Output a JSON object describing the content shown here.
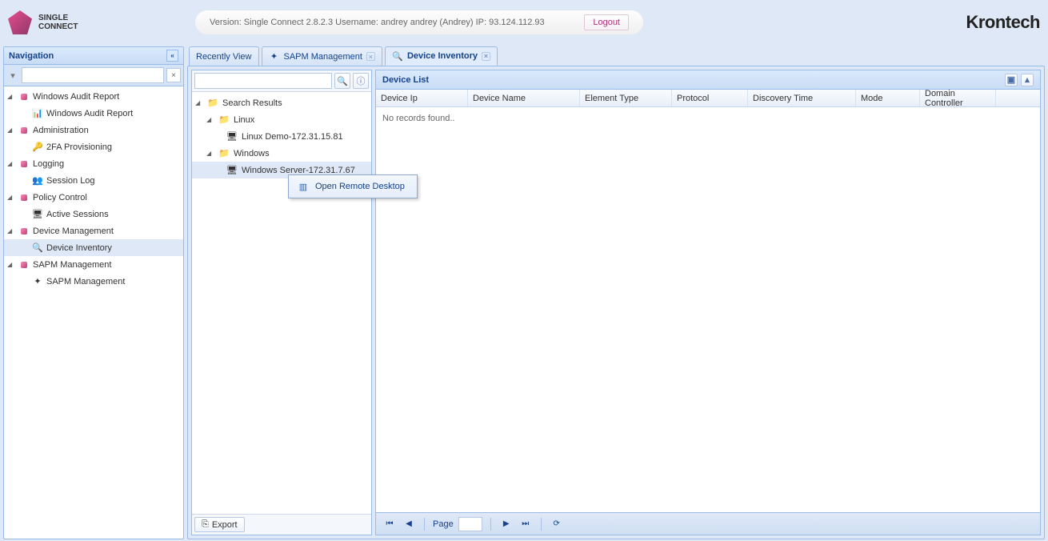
{
  "logo": {
    "line1": "SINGLE",
    "line2": "CONNECT"
  },
  "brand": "Krontech",
  "infoBar": "Version: Single Connect 2.8.2.3 Username: andrey andrey (Andrey) IP: 93.124.112.93",
  "logout": "Logout",
  "nav": {
    "title": "Navigation",
    "items": [
      {
        "label": "Windows Audit Report",
        "children": [
          {
            "label": "Windows Audit Report"
          }
        ]
      },
      {
        "label": "Administration",
        "children": [
          {
            "label": "2FA Provisioning"
          }
        ]
      },
      {
        "label": "Logging",
        "children": [
          {
            "label": "Session Log"
          }
        ]
      },
      {
        "label": "Policy Control",
        "children": [
          {
            "label": "Active Sessions"
          }
        ]
      },
      {
        "label": "Device Management",
        "children": [
          {
            "label": "Device Inventory",
            "selected": true
          }
        ]
      },
      {
        "label": "SAPM Management",
        "children": [
          {
            "label": "SAPM Management"
          }
        ]
      }
    ]
  },
  "tabs": [
    {
      "label": "Recently View",
      "closable": false
    },
    {
      "label": "SAPM Management",
      "closable": true
    },
    {
      "label": "Device Inventory",
      "closable": true,
      "active": true
    }
  ],
  "searchTree": {
    "root": "Search Results",
    "groups": [
      {
        "label": "Linux",
        "children": [
          {
            "label": "Linux Demo-172.31.15.81"
          }
        ]
      },
      {
        "label": "Windows",
        "children": [
          {
            "label": "Windows Server-172.31.7.67",
            "selected": true
          }
        ]
      }
    ]
  },
  "exportLabel": "Export",
  "grid": {
    "title": "Device List",
    "columns": [
      "Device Ip",
      "Device Name",
      "Element Type",
      "Protocol",
      "Discovery Time",
      "Mode",
      "Domain Controller"
    ],
    "empty": "No records found..",
    "pageLabel": "Page"
  },
  "contextMenu": {
    "openRemote": "Open Remote Desktop"
  }
}
